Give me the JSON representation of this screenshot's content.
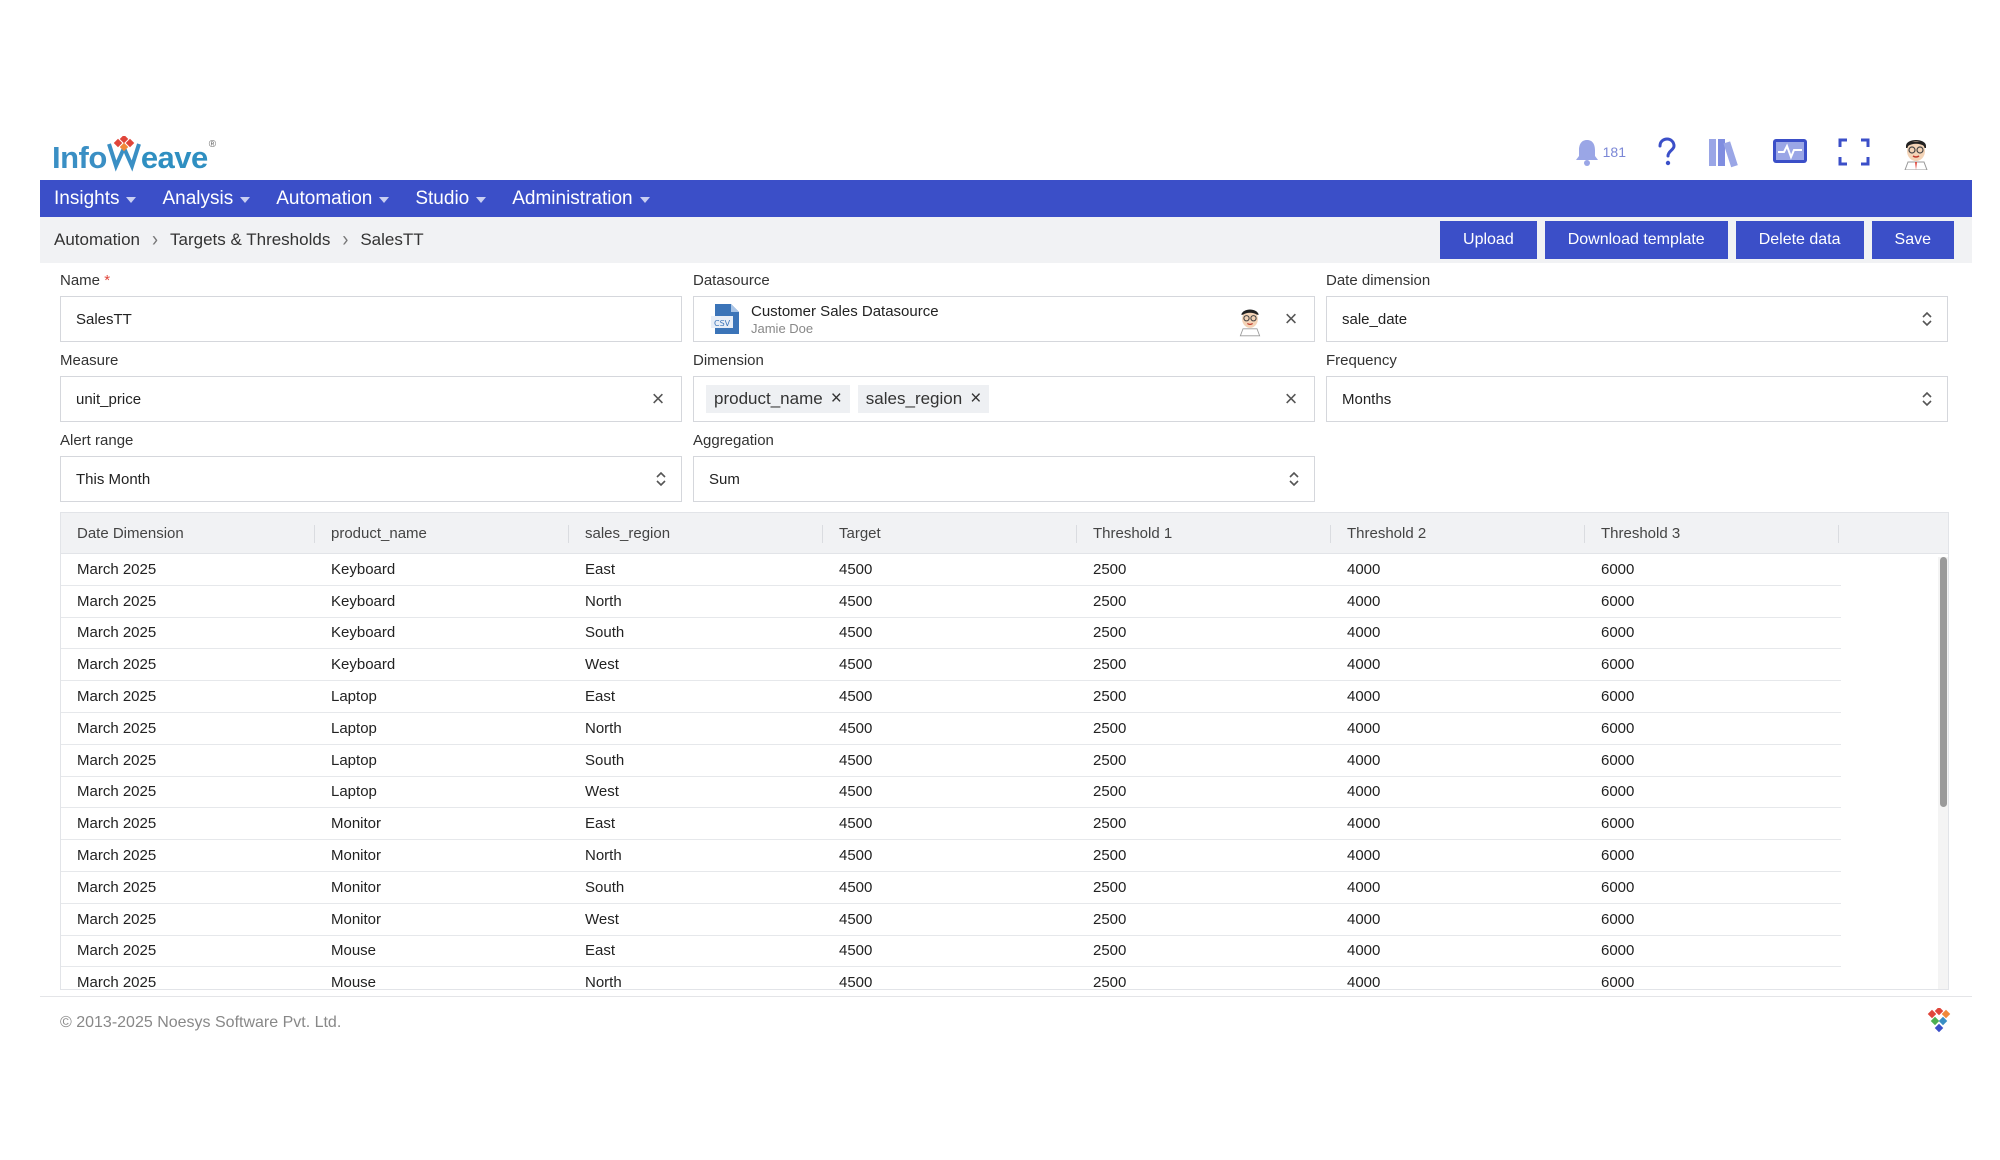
{
  "brand": {
    "logo_text_left": "Info",
    "logo_text_right": "eave",
    "registered": "®"
  },
  "header": {
    "notification_count": "181"
  },
  "nav": {
    "items": [
      {
        "label": "Insights"
      },
      {
        "label": "Analysis"
      },
      {
        "label": "Automation"
      },
      {
        "label": "Studio"
      },
      {
        "label": "Administration"
      }
    ]
  },
  "breadcrumb": {
    "items": [
      "Automation",
      "Targets & Thresholds",
      "SalesTT"
    ]
  },
  "actions": {
    "upload": "Upload",
    "download_template": "Download template",
    "delete_data": "Delete data",
    "save": "Save"
  },
  "form": {
    "name": {
      "label": "Name",
      "required_mark": "*",
      "value": "SalesTT"
    },
    "datasource": {
      "label": "Datasource",
      "name": "Customer Sales Datasource",
      "owner": "Jamie Doe"
    },
    "date_dimension": {
      "label": "Date dimension",
      "value": "sale_date"
    },
    "measure": {
      "label": "Measure",
      "value": "unit_price"
    },
    "dimension": {
      "label": "Dimension",
      "chips": [
        "product_name",
        "sales_region"
      ]
    },
    "frequency": {
      "label": "Frequency",
      "value": "Months"
    },
    "alert_range": {
      "label": "Alert range",
      "value": "This Month"
    },
    "aggregation": {
      "label": "Aggregation",
      "value": "Sum"
    }
  },
  "table": {
    "columns": [
      "Date Dimension",
      "product_name",
      "sales_region",
      "Target",
      "Threshold 1",
      "Threshold 2",
      "Threshold 3"
    ],
    "rows": [
      [
        "March 2025",
        "Keyboard",
        "East",
        "4500",
        "2500",
        "4000",
        "6000"
      ],
      [
        "March 2025",
        "Keyboard",
        "North",
        "4500",
        "2500",
        "4000",
        "6000"
      ],
      [
        "March 2025",
        "Keyboard",
        "South",
        "4500",
        "2500",
        "4000",
        "6000"
      ],
      [
        "March 2025",
        "Keyboard",
        "West",
        "4500",
        "2500",
        "4000",
        "6000"
      ],
      [
        "March 2025",
        "Laptop",
        "East",
        "4500",
        "2500",
        "4000",
        "6000"
      ],
      [
        "March 2025",
        "Laptop",
        "North",
        "4500",
        "2500",
        "4000",
        "6000"
      ],
      [
        "March 2025",
        "Laptop",
        "South",
        "4500",
        "2500",
        "4000",
        "6000"
      ],
      [
        "March 2025",
        "Laptop",
        "West",
        "4500",
        "2500",
        "4000",
        "6000"
      ],
      [
        "March 2025",
        "Monitor",
        "East",
        "4500",
        "2500",
        "4000",
        "6000"
      ],
      [
        "March 2025",
        "Monitor",
        "North",
        "4500",
        "2500",
        "4000",
        "6000"
      ],
      [
        "March 2025",
        "Monitor",
        "South",
        "4500",
        "2500",
        "4000",
        "6000"
      ],
      [
        "March 2025",
        "Monitor",
        "West",
        "4500",
        "2500",
        "4000",
        "6000"
      ],
      [
        "March 2025",
        "Mouse",
        "East",
        "4500",
        "2500",
        "4000",
        "6000"
      ],
      [
        "March 2025",
        "Mouse",
        "North",
        "4500",
        "2500",
        "4000",
        "6000"
      ]
    ]
  },
  "footer": {
    "copyright": "© 2013-2025 Noesys Software Pvt. Ltd."
  },
  "colors": {
    "brand_blue": "#3b4fc8",
    "accent_red": "#e0453a"
  },
  "icons": [
    "bell-icon",
    "help-icon",
    "library-icon",
    "monitor-icon",
    "fullscreen-icon",
    "user-avatar",
    "csv-file-icon",
    "close-icon",
    "updown-icon",
    "chevron-right-icon"
  ]
}
